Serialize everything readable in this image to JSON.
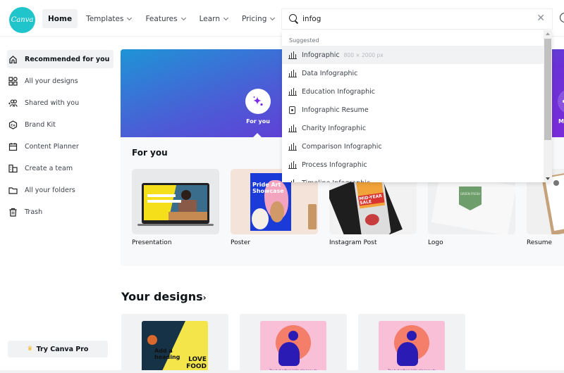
{
  "app": {
    "logo_text": "Canva"
  },
  "nav": {
    "items": [
      {
        "label": "Home",
        "active": true,
        "has_dropdown": false
      },
      {
        "label": "Templates",
        "has_dropdown": true
      },
      {
        "label": "Features",
        "has_dropdown": true
      },
      {
        "label": "Learn",
        "has_dropdown": true
      },
      {
        "label": "Pricing",
        "has_dropdown": true
      }
    ]
  },
  "search": {
    "value": "infog",
    "clear_icon": "close-icon",
    "dropdown": {
      "heading": "Suggested",
      "items": [
        {
          "label": "Infographic",
          "sub": "800 × 2000 px",
          "icon": "bar-chart-icon",
          "highlighted": true
        },
        {
          "label": "Data Infographic",
          "icon": "bar-chart-icon"
        },
        {
          "label": "Education Infographic",
          "icon": "bar-chart-icon"
        },
        {
          "label": "Infographic Resume",
          "icon": "document-icon"
        },
        {
          "label": "Charity Infographic",
          "icon": "bar-chart-icon"
        },
        {
          "label": "Comparison Infographic",
          "icon": "bar-chart-icon"
        },
        {
          "label": "Process Infographic",
          "icon": "bar-chart-icon"
        },
        {
          "label": "Timeline Infographic",
          "icon": "bar-chart-icon"
        }
      ]
    }
  },
  "sidebar": {
    "items": [
      {
        "label": "Recommended for you",
        "icon": "home-icon",
        "active": true
      },
      {
        "label": "All your designs",
        "icon": "grid-icon"
      },
      {
        "label": "Shared with you",
        "icon": "people-icon"
      },
      {
        "label": "Brand Kit",
        "icon": "brand-kit-icon"
      },
      {
        "label": "Content Planner",
        "icon": "calendar-icon"
      },
      {
        "label": "Create a team",
        "icon": "team-icon"
      },
      {
        "label": "All your folders",
        "icon": "folder-icon"
      },
      {
        "label": "Trash",
        "icon": "trash-icon"
      }
    ],
    "pro_button": "Try Canva Pro"
  },
  "hero": {
    "tab_label": "For you",
    "second_tab_label": "M"
  },
  "for_you": {
    "title": "For you",
    "templates": [
      {
        "label": "Presentation"
      },
      {
        "label": "Poster",
        "thumb_text": "Pride Art Showcase"
      },
      {
        "label": "Instagram Post",
        "thumb_text": "MID-YEAR SALE"
      },
      {
        "label": "Logo",
        "thumb_text": "GREEN FRESH"
      },
      {
        "label": "Resume"
      }
    ]
  },
  "your_designs": {
    "title": "Your designs",
    "arrow": "›",
    "cards": [
      {
        "thumb_text_1": "Add a heading",
        "thumb_text_2": "LOVE FOOD"
      },
      {
        "thumb_text": "The bud adhere lollip gile know fo"
      },
      {
        "thumb_text": "The bud adhere lollip gile know fo"
      }
    ]
  },
  "colors": {
    "brand": "#20c4cb",
    "accent_purple": "#7d2ae8",
    "sidebar_active_bg": "#f1f2f4",
    "crown": "#f6b624"
  }
}
